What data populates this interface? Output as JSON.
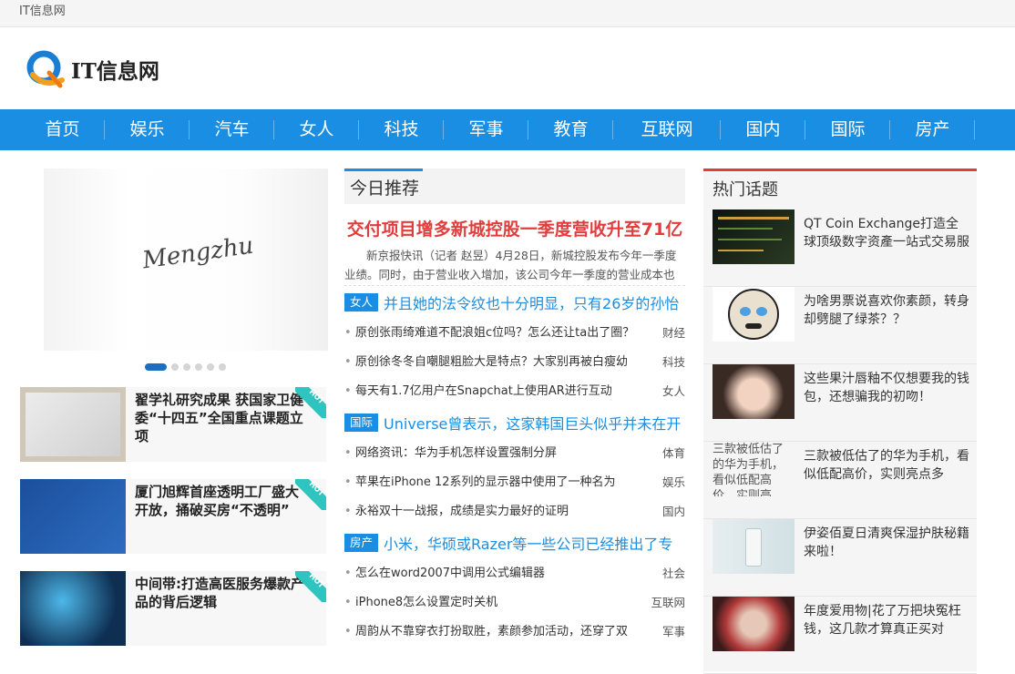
{
  "topbar": {
    "site": "IT信息网"
  },
  "logo": {
    "text": "IT信息网"
  },
  "nav": [
    {
      "label": "首页",
      "width": 93
    },
    {
      "label": "娱乐",
      "width": 93
    },
    {
      "label": "汽车",
      "width": 93
    },
    {
      "label": "女人",
      "width": 93
    },
    {
      "label": "科技",
      "width": 93
    },
    {
      "label": "军事",
      "width": 93
    },
    {
      "label": "教育",
      "width": 93
    },
    {
      "label": "互联网",
      "width": 118
    },
    {
      "label": "国内",
      "width": 93
    },
    {
      "label": "国际",
      "width": 93
    },
    {
      "label": "房产",
      "width": 93
    }
  ],
  "slider": {
    "signature": "Mengzhu",
    "dots": 6,
    "active": 0
  },
  "left_news": [
    {
      "title": "翟学礼研究成果 获国家卫健委“十四五”全国重点课题立项",
      "badge": "HOT"
    },
    {
      "title": "厦门旭辉首座透明工厂盛大开放，捅破买房“不透明”",
      "badge": "HOT"
    },
    {
      "title": "中间带:打造高医服务爆款产品的背后逻辑",
      "badge": "HOT"
    }
  ],
  "middle": {
    "heading": "今日推荐",
    "featured": {
      "title": "交付项目增多新城控股一季度营收升至71亿",
      "desc": "新京报快讯（记者 赵昱）4月28日，新城控股发布今年一季度业绩。同时，由于营业收入增加，该公司今年一季度的营业成本也出现了"
    },
    "sections": [
      {
        "tag": "女人",
        "title": "并且她的法令纹也十分明显，只有26岁的孙怡",
        "items": [
          {
            "text": "原创张雨绮难道不配浪姐c位吗？怎么还让ta出了圈？",
            "cat": "财经"
          },
          {
            "text": "原创徐冬冬自嘲腿粗脸大是特点？大家别再被白瘦幼",
            "cat": "科技"
          },
          {
            "text": "每天有1.7亿用户在Snapchat上使用AR进行互动",
            "cat": "女人"
          }
        ]
      },
      {
        "tag": "国际",
        "title": "Universe曾表示，这家韩国巨头似乎并未在开",
        "items": [
          {
            "text": "网络资讯：华为手机怎样设置强制分屏",
            "cat": "体育"
          },
          {
            "text": "苹果在iPhone 12系列的显示器中使用了一种名为",
            "cat": "娱乐"
          },
          {
            "text": "永裕双十一战报，成绩是实力最好的证明",
            "cat": "国内"
          }
        ]
      },
      {
        "tag": "房产",
        "title": "小米，华硕或Razer等一些公司已经推出了专",
        "items": [
          {
            "text": "怎么在word2007中调用公式编辑器",
            "cat": "社会"
          },
          {
            "text": "iPhone8怎么设置定时关机",
            "cat": "互联网"
          },
          {
            "text": "周韵从不靠穿衣打扮取胜，素颜参加活动，还穿了双",
            "cat": "军事"
          }
        ]
      }
    ]
  },
  "right": {
    "heading": "热门话题",
    "topics": [
      {
        "text": "QT Coin Exchange打造全球顶级数字资產一站式交易服",
        "thumb": "crypto"
      },
      {
        "text": "为啥男票说喜欢你素颜，转身却劈腿了绿茶？？",
        "thumb": "meme"
      },
      {
        "text": "这些果汁唇釉不仅想要我的钱包，还想骗我的初吻！",
        "thumb": "portrait"
      },
      {
        "text": "三款被低估了的华为手机，看似低配高价，实则亮点多",
        "thumb": "broken",
        "alt": "三款被低估了的华为手机，看似低配高价，实则亮"
      },
      {
        "text": "伊姿佰夏日清爽保湿护肤秘籍来啦！",
        "thumb": "product"
      },
      {
        "text": "年度爱用物|花了万把块冤枉钱，这几款才算真正买对",
        "thumb": "man"
      }
    ]
  }
}
